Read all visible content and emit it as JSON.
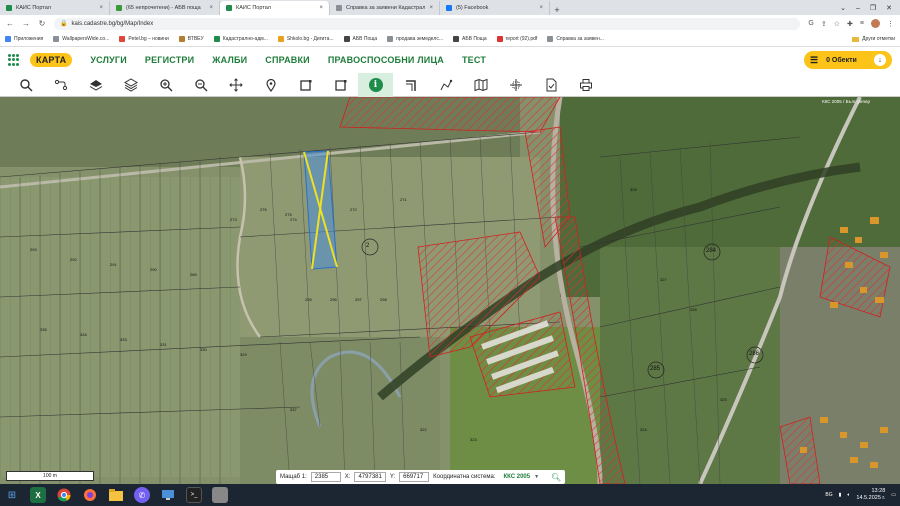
{
  "browser": {
    "tabs": [
      {
        "label": "КАИС Портал",
        "color": "#1e8c4a",
        "active": false
      },
      {
        "label": "(65 непрочетени) - АБВ поща",
        "color": "#3a9a3a",
        "active": false
      },
      {
        "label": "КАИС Портал",
        "color": "#1e8c4a",
        "active": true
      },
      {
        "label": "Справка за заявени Кадастрал...",
        "color": "#8a8f96",
        "active": false
      },
      {
        "label": "(5) Facebook",
        "color": "#1877f2",
        "active": false
      }
    ],
    "url": "kais.cadastre.bg/bg/Map/Index",
    "bookmarks": [
      "Приложения",
      "WallpapersWide.co...",
      "Petel.bg – новини",
      "ВТВЕУ",
      "Кадастрално-адм...",
      "Shkolo.bg - Дигита...",
      "АБВ Поща",
      "продава земеделс...",
      "АБВ Поща",
      "report (92).pdf",
      "Справка за заявен..."
    ],
    "other_bookmarks": "Други отметки"
  },
  "app": {
    "nav": [
      "КАРТА",
      "УСЛУГИ",
      "РЕГИСТРИ",
      "ЖАЛБИ",
      "СПРАВКИ",
      "ПРАВОСПОСОБНИ ЛИЦА",
      "ТЕСТ"
    ],
    "objects_button": "0 Обекти"
  },
  "toolbar": {
    "tools": [
      "search-icon",
      "route-icon",
      "layers-icon",
      "layers-stack-icon",
      "zoom-in-icon",
      "zoom-out-icon",
      "pan-icon",
      "pin-icon",
      "select-rect-icon",
      "select-area-icon",
      "info-icon",
      "corner-icon",
      "measure-icon",
      "map-icon",
      "crosshair-icon",
      "document-icon",
      "print-icon"
    ]
  },
  "map": {
    "crs_note": "ККС 2005 / Бълг. репер",
    "parcel_labels": [
      "293",
      "292",
      "291",
      "290",
      "289",
      "276",
      "275",
      "274",
      "273",
      "272",
      "271",
      "2",
      "298",
      "297",
      "296",
      "295",
      "284",
      "285",
      "286",
      "337",
      "335",
      "334",
      "333",
      "331",
      "330",
      "329",
      "328",
      "327",
      "326",
      "325",
      "324",
      "323",
      "322",
      "321",
      "320",
      "319",
      "318",
      "317",
      "316",
      "315",
      "314",
      "313",
      "312",
      "311",
      "310",
      "309",
      "308"
    ],
    "plot_numbers": [
      "2",
      "284",
      "285",
      "286"
    ]
  },
  "scale": {
    "label": "100 m"
  },
  "status": {
    "scale_label": "Мащаб 1:",
    "scale_value": "2385",
    "x_label": "X:",
    "x_value": "4797381",
    "y_label": "Y:",
    "y_value": "669717",
    "crs_label": "Координатна система:",
    "crs_value": "ККС 2005"
  },
  "taskbar": {
    "time": "13:28",
    "date": "14.5.2025 г.",
    "lang": "BG"
  }
}
